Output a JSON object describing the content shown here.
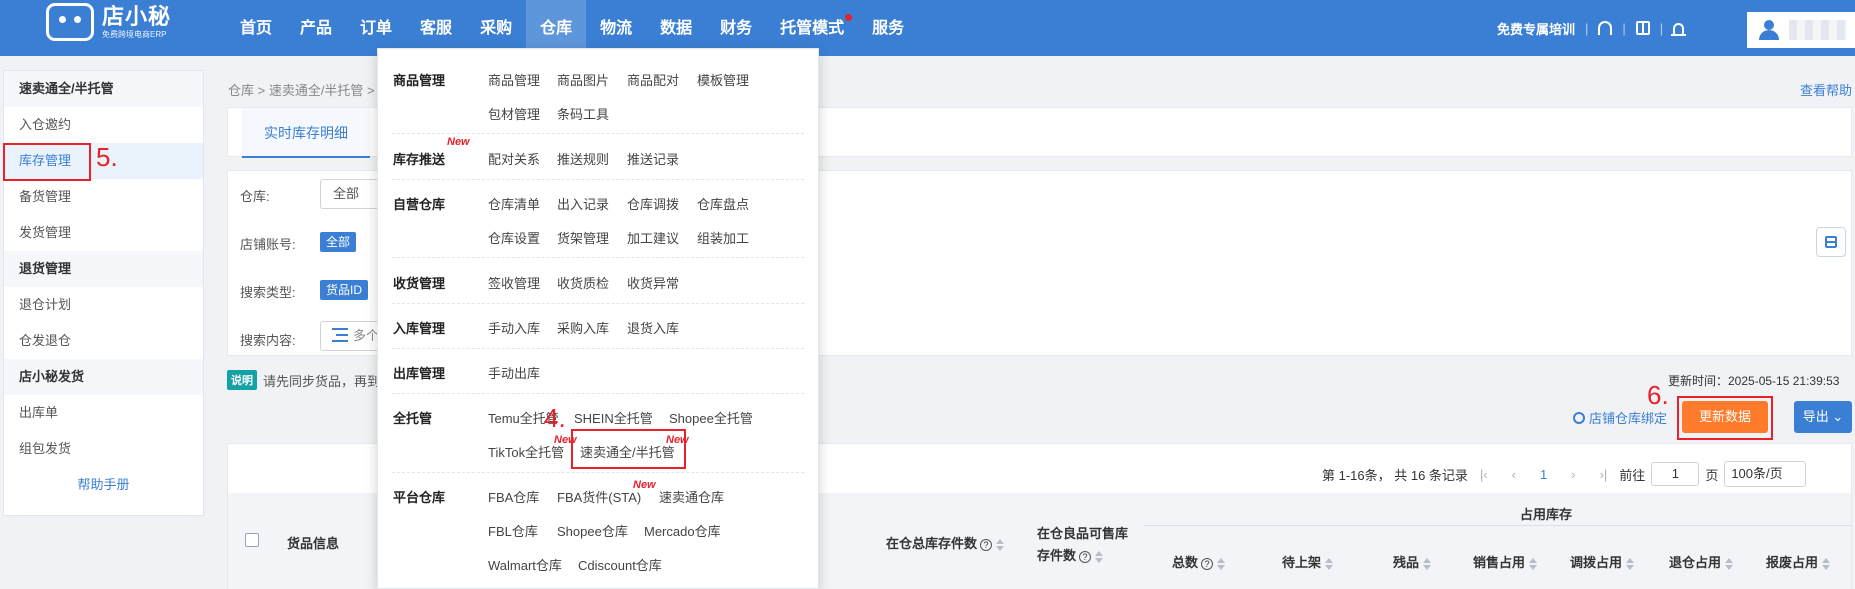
{
  "logo": {
    "name": "店小秘",
    "tagline": "免费跨境电商ERP"
  },
  "nav": [
    {
      "label": "首页"
    },
    {
      "label": "产品"
    },
    {
      "label": "订单"
    },
    {
      "label": "客服"
    },
    {
      "label": "采购"
    },
    {
      "label": "仓库",
      "active": true
    },
    {
      "label": "物流"
    },
    {
      "label": "数据"
    },
    {
      "label": "财务"
    },
    {
      "label": "托管模式",
      "dot": true
    },
    {
      "label": "服务"
    }
  ],
  "top_right": {
    "training": "免费专属培训",
    "sep": "|",
    "icons": [
      "headset-icon",
      "book-icon",
      "bell-icon"
    ]
  },
  "sidebar": {
    "groups": [
      {
        "title": "速卖通全/半托管",
        "items": [
          "入仓邀约",
          "库存管理",
          "备货管理",
          "发货管理"
        ],
        "active": "库存管理"
      },
      {
        "title": "退货管理",
        "items": [
          "退仓计划",
          "仓发退仓"
        ]
      },
      {
        "title": "店小秘发货",
        "items": [
          "出库单",
          "组包发货"
        ]
      }
    ],
    "help": "帮助手册"
  },
  "breadcrumb": "仓库 > 速卖通全/半托管 >",
  "help_link": "查看帮助",
  "tab_active": "实时库存明细",
  "filters": {
    "warehouse_label": "仓库:",
    "warehouse_value": "全部",
    "shop_label": "店铺账号:",
    "shop_value": "全部",
    "search_type_label": "搜索类型:",
    "search_type_value": "货品ID",
    "search_content_label": "搜索内容:",
    "search_content_value": "多个"
  },
  "note": {
    "badge": "说明",
    "text": "请先同步货品，再到"
  },
  "update_time": "更新时间：2025-05-15 21:39:53",
  "bind_link": "店铺仓库绑定",
  "update_button": "更新数据",
  "export_button": "导出",
  "pager": {
    "summary": "第 1-16条， 共 16 条记录",
    "current": "1",
    "goto": "前往",
    "page_input": "1",
    "page_unit": "页",
    "page_size": "100条/页"
  },
  "table": {
    "col_goods": "货品信息",
    "col_total_stock": "在仓总库存件数",
    "col_sellable_1": "在仓良品可售库",
    "col_sellable_2": "存件数",
    "occupied_group": "占用库存",
    "occupied": [
      "总数",
      "待上架",
      "残品",
      "销售占用",
      "调拨占用",
      "退仓占用",
      "报废占用"
    ]
  },
  "menu": {
    "sections": [
      {
        "category": "商品管理",
        "links": [
          "商品管理",
          "商品图片",
          "商品配对",
          "模板管理",
          "包材管理",
          "条码工具"
        ]
      },
      {
        "category": "库存推送",
        "links": [
          "配对关系",
          "推送规则",
          "推送记录"
        ]
      },
      {
        "category": "自营仓库",
        "links": [
          "仓库清单",
          "出入记录",
          "仓库调拨",
          "仓库盘点",
          "仓库设置",
          "货架管理",
          "加工建议",
          "组装加工"
        ]
      },
      {
        "category": "收货管理",
        "links": [
          "签收管理",
          "收货质检",
          "收货异常"
        ]
      },
      {
        "category": "入库管理",
        "links": [
          "手动入库",
          "采购入库",
          "退货入库"
        ]
      },
      {
        "category": "出库管理",
        "links": [
          "手动出库"
        ]
      },
      {
        "category": "全托管",
        "links": [
          "Temu全托管",
          "SHEIN全托管",
          "Shopee全托管",
          "TikTok全托管",
          "速卖通全/半托管"
        ]
      },
      {
        "category": "平台仓库",
        "links": [
          "FBA仓库",
          "FBA货件(STA)",
          "速卖通仓库",
          "FBL仓库",
          "Shopee仓库",
          "Mercado仓库",
          "Walmart仓库",
          "Cdiscount仓库"
        ]
      }
    ],
    "new_tag": "New"
  },
  "annotations": [
    "4.",
    "5.",
    "6."
  ],
  "colors": {
    "brand": "#3b7fd4",
    "accent": "#fe7b2b",
    "annotation": "#e8212b"
  }
}
